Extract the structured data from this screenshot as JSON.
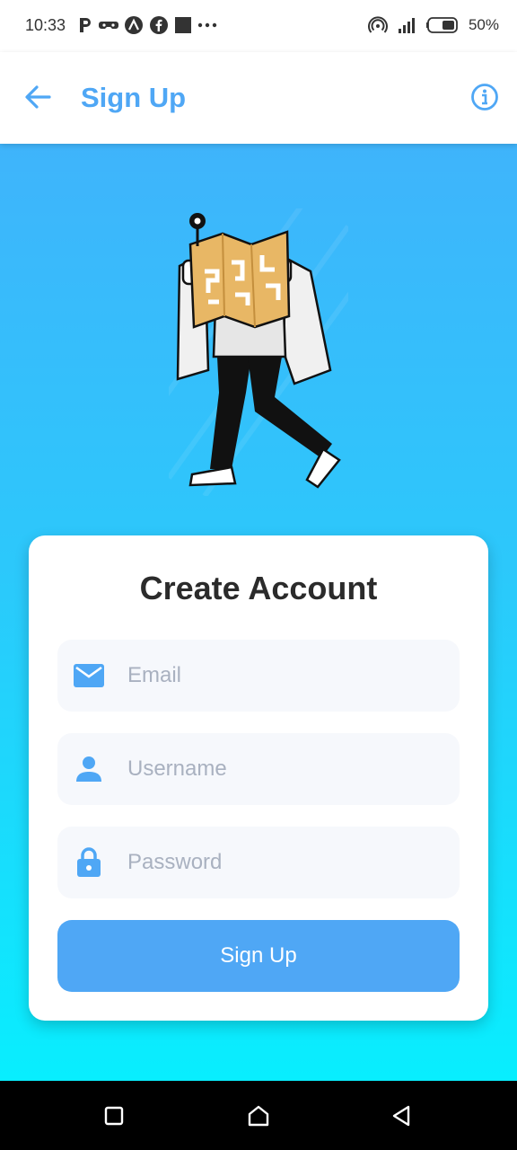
{
  "status_bar": {
    "time": "10:33",
    "battery": "50%",
    "left_icons": [
      "parking-icon",
      "game-controller-icon",
      "app-a-icon",
      "facebook-icon",
      "square-notification-icon",
      "more-dots-icon"
    ],
    "right_icons": [
      "hotspot-icon",
      "signal-icon",
      "battery-icon"
    ]
  },
  "app_bar": {
    "title": "Sign Up",
    "back_icon": "arrow-back-icon",
    "info_icon": "info-icon"
  },
  "card": {
    "title": "Create Account",
    "fields": {
      "email": {
        "placeholder": "Email",
        "icon": "mail-icon"
      },
      "username": {
        "placeholder": "Username",
        "icon": "person-icon"
      },
      "password": {
        "placeholder": "Password",
        "icon": "lock-icon"
      }
    },
    "submit_label": "Sign Up"
  },
  "colors": {
    "accent": "#4fa7f5",
    "gradient_top": "#3fb4fb",
    "gradient_bottom": "#08eefe",
    "card_bg": "#ffffff",
    "field_bg": "#f6f8fc",
    "placeholder": "#a9b1c0"
  },
  "nav_bar": {
    "icons": [
      "recent-apps-icon",
      "home-icon",
      "back-triangle-icon"
    ]
  }
}
